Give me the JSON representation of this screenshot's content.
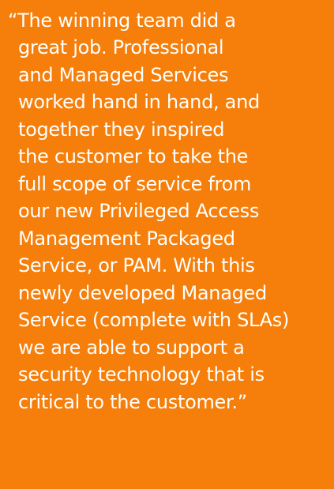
{
  "quote": {
    "lines": [
      "“The winning team did a",
      "great job. Professional",
      "and Managed Services",
      "worked hand in hand, and",
      "together they inspired",
      "the customer to take the",
      "full scope of service from",
      "our new Privileged Access",
      "Management Packaged",
      "Service, or PAM. With this",
      "newly developed Managed",
      "Service (complete with SLAs)",
      "we are able to support a",
      "security technology that is",
      "critical to the customer.”"
    ]
  },
  "colors": {
    "background": "#f57f0a",
    "text": "#ffffff"
  }
}
